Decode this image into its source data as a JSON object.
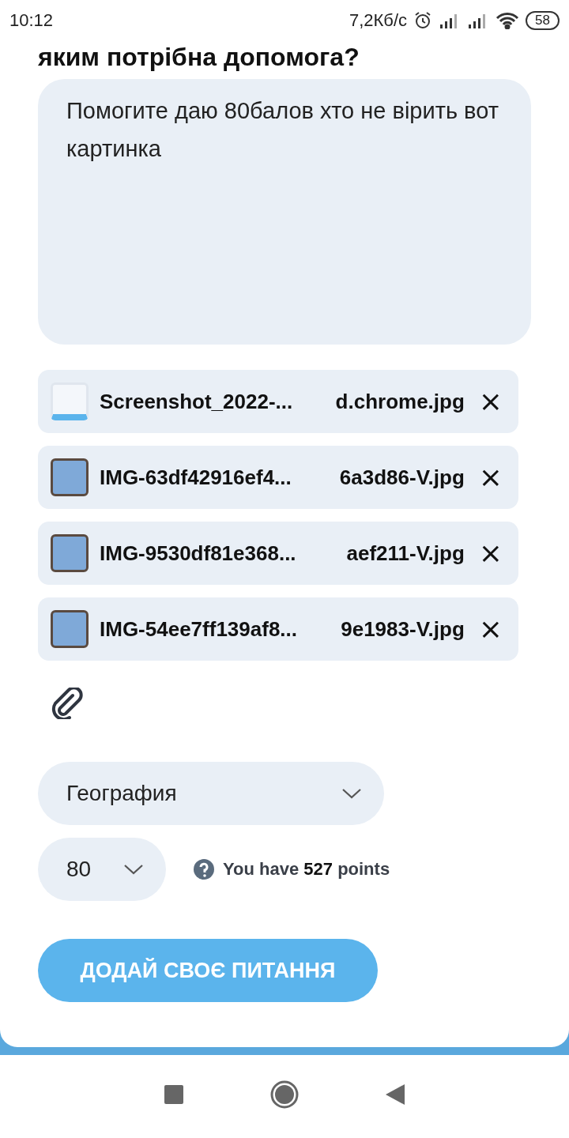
{
  "status_bar": {
    "time": "10:12",
    "network_speed": "7,2Кб/с",
    "battery": "58"
  },
  "heading": "яким потрібна допомога?",
  "question": {
    "value": "Помогите даю 80балов хто не вірить вот картинка"
  },
  "attachments": [
    {
      "name_start": "Screenshot_2022-...",
      "name_end": "d.chrome.jpg",
      "remove": "×"
    },
    {
      "name_start": "IMG-63df42916ef4...",
      "name_end": "6a3d86-V.jpg",
      "remove": "×"
    },
    {
      "name_start": "IMG-9530df81e368...",
      "name_end": "aef211-V.jpg",
      "remove": "×"
    },
    {
      "name_start": "IMG-54ee7ff139af8...",
      "name_end": "9e1983-V.jpg",
      "remove": "×"
    }
  ],
  "subject_select": {
    "value": "География"
  },
  "points_select": {
    "value": "80"
  },
  "points_info": "You have **527** points",
  "submit_button": "ДОДАЙ СВОЄ ПИТАННЯ"
}
